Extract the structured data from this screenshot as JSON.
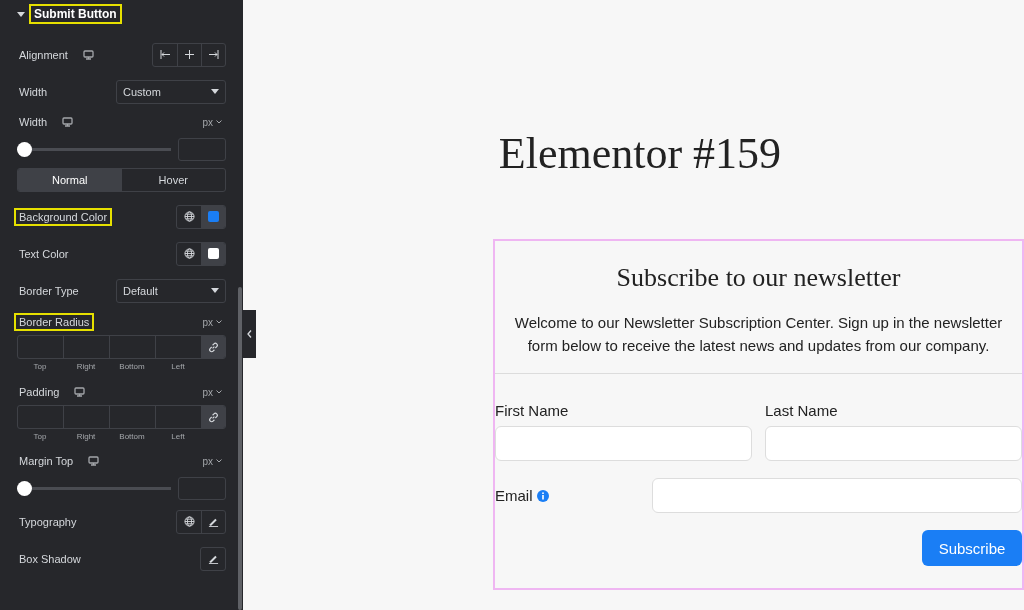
{
  "panel": {
    "section_title": "Submit Button",
    "section_highlighted": true,
    "expanded": true,
    "controls": [
      {
        "kind": "align",
        "label": "Alignment",
        "responsive": true,
        "highlighted": false
      },
      {
        "kind": "select",
        "label": "Width",
        "value": "Custom",
        "highlighted": false
      },
      {
        "kind": "slider",
        "label": "Width",
        "responsive": true,
        "unit": "px",
        "level": 0,
        "highlighted": false
      },
      {
        "kind": "tabs",
        "tabs": [
          {
            "label": "Normal",
            "selected": true
          },
          {
            "label": "Hover",
            "selected": false
          }
        ]
      },
      {
        "kind": "color",
        "label": "Background Color",
        "color": "#1a7ef5",
        "highlighted": true
      },
      {
        "kind": "color",
        "label": "Text Color",
        "color": "#ffffff",
        "highlighted": false
      },
      {
        "kind": "select",
        "label": "Border Type",
        "value": "Default",
        "highlighted": false
      },
      {
        "kind": "dimensions",
        "label": "Border Radius",
        "responsive": false,
        "unit": "px",
        "sides": [
          "Top",
          "Right",
          "Bottom",
          "Left"
        ],
        "highlighted": true
      },
      {
        "kind": "dimensions",
        "label": "Padding",
        "responsive": true,
        "unit": "px",
        "sides": [
          "Top",
          "Right",
          "Bottom",
          "Left"
        ],
        "highlighted": false
      },
      {
        "kind": "slider",
        "label": "Margin Top",
        "responsive": true,
        "unit": "px",
        "level": 0,
        "highlighted": false
      },
      {
        "kind": "popover",
        "label": "Typography",
        "global": true,
        "highlighted": false
      },
      {
        "kind": "popover",
        "label": "Box Shadow",
        "global": false,
        "highlighted": false
      }
    ]
  },
  "page": {
    "title": "Elementor #159",
    "form": {
      "heading": "Subscribe to our newsletter",
      "intro": "Welcome to our Newsletter Subscription Center. Sign up in the newsletter form below to receive the latest news and updates from our company.",
      "fields": [
        {
          "label": "First Name",
          "info": false
        },
        {
          "label": "Last Name",
          "info": false
        },
        {
          "label": "Email",
          "info": true
        }
      ],
      "submit": "Subscribe"
    }
  }
}
